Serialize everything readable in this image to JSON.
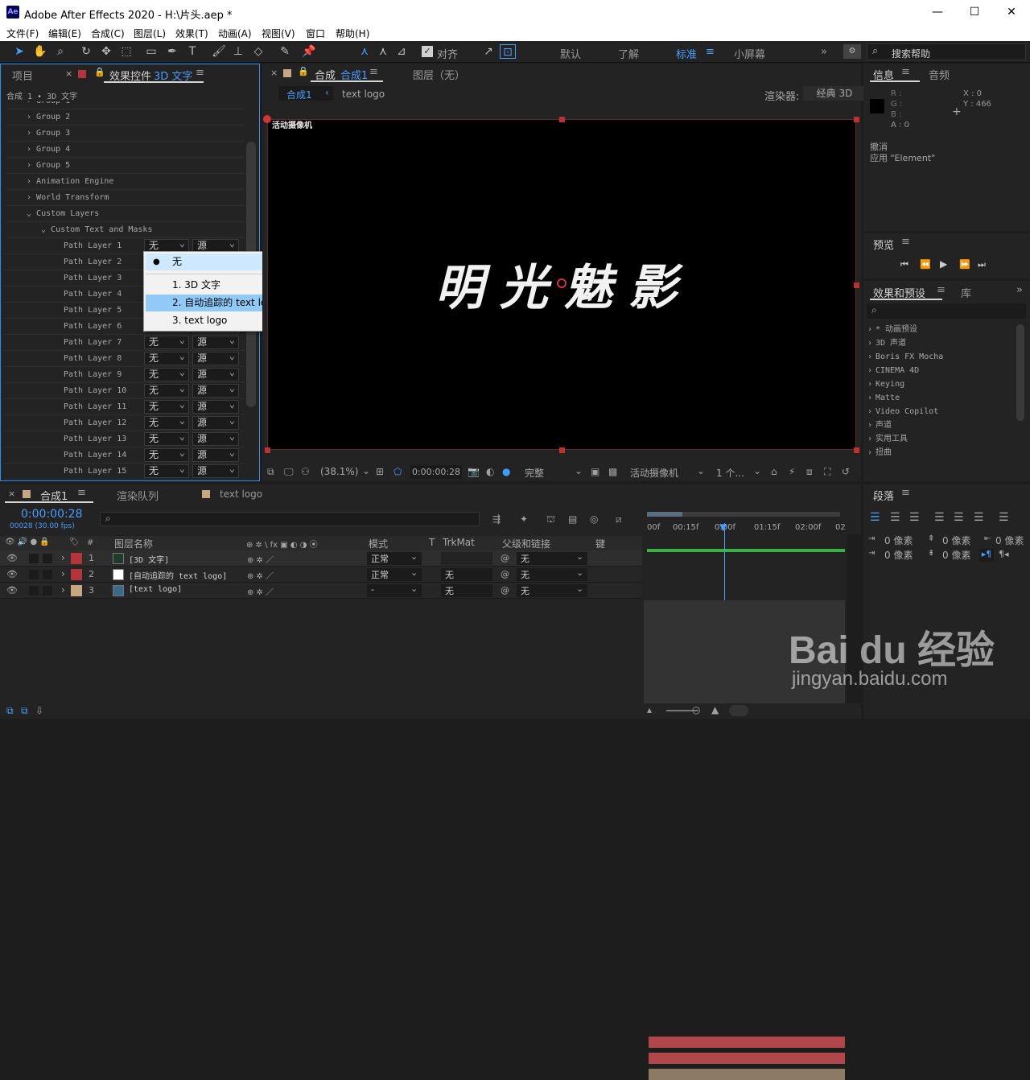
{
  "app": {
    "title": "Adobe After Effects 2020 - H:\\片头.aep *",
    "logo": "Ae"
  },
  "menu": [
    "文件(F)",
    "编辑(E)",
    "合成(C)",
    "图层(L)",
    "效果(T)",
    "动画(A)",
    "视图(V)",
    "窗口",
    "帮助(H)"
  ],
  "toolbar": {
    "align_label": "对齐",
    "workspaces": [
      "默认",
      "了解",
      "标准",
      "小屏幕"
    ],
    "active_workspace": "标准",
    "search_placeholder": "搜索帮助"
  },
  "left_panel": {
    "tab_project": "项目",
    "tab_effects": "效果控件",
    "tab_effects_layer": "3D 文字",
    "breadcrumb": "合成 1 • 3D 文字",
    "rows": [
      "Group 2",
      "Group 3",
      "Group 4",
      "Group 5",
      "Animation Engine",
      "World Transform",
      "Custom Layers",
      "Custom Text and Masks",
      "Path Layer 1",
      "Path Layer 2",
      "Path Layer 3",
      "Path Layer 4",
      "Path Layer 5",
      "Path Layer 6",
      "Path Layer 7",
      "Path Layer 8",
      "Path Layer 9",
      "Path Layer 10",
      "Path Layer 11",
      "Path Layer 12",
      "Path Layer 13",
      "Path Layer 14",
      "Path Layer 15"
    ],
    "dropdown_none": "无",
    "dropdown_source": "源"
  },
  "dropdown_menu": {
    "items": [
      "无",
      "1. 3D 文字",
      "2. 自动追踪的 text logo",
      "3. text logo"
    ],
    "selected": "无",
    "highlighted": "2. 自动追踪的 text logo"
  },
  "comp_panel": {
    "tab_label": "合成",
    "tab_name": "合成1",
    "layer_tab": "图层（无）",
    "sub_tab": "合成1",
    "sub_tab2": "text logo",
    "renderer_label": "渲染器:",
    "renderer_value": "经典 3D",
    "camera_label": "活动摄像机",
    "canvas_text": "明光魅影",
    "zoom": "(38.1%)",
    "timecode": "0:00:00:28",
    "quality": "完整",
    "view_camera": "活动摄像机",
    "views": "1 个..."
  },
  "info_panel": {
    "tab_info": "信息",
    "tab_audio": "音频",
    "r": "R :",
    "g": "G :",
    "b": "B :",
    "a": "A : 0",
    "x": "X : 0",
    "y": "Y : 466",
    "undo": "撤消",
    "apply": "应用 \"Element\""
  },
  "preview_panel": {
    "tab": "预览"
  },
  "effects_panel": {
    "tab": "效果和预设",
    "tab_lib": "库",
    "items": [
      "* 动画预设",
      "3D 声道",
      "Boris FX Mocha",
      "CINEMA 4D",
      "Keying",
      "Matte",
      "Video Copilot",
      "声道",
      "实用工具",
      "扭曲"
    ]
  },
  "timeline": {
    "tab": "合成1",
    "render_queue": "渲染队列",
    "tab3": "text logo",
    "timecode": "0:00:00:28",
    "fps": "00028 (30.00 fps)",
    "col_layer_name": "图层名称",
    "col_mode": "模式",
    "col_t": "T",
    "col_trkmat": "TrkMat",
    "col_parent": "父级和链接",
    "col_key": "键",
    "ruler": [
      "00f",
      "00:15f",
      "0:00f",
      "01:15f",
      "02:00f",
      "02"
    ],
    "layers": [
      {
        "num": "1",
        "name": "[3D 文字]",
        "mode": "正常",
        "trkmat": "",
        "parent": "无",
        "color": "#b3343a"
      },
      {
        "num": "2",
        "name": "[自动追踪的 text logo]",
        "mode": "正常",
        "trkmat": "无",
        "parent": "无",
        "color": "#b3343a"
      },
      {
        "num": "3",
        "name": "[text logo]",
        "mode": "-",
        "trkmat": "无",
        "parent": "无",
        "color": "#c7a781"
      }
    ]
  },
  "paragraph_panel": {
    "tab": "段落",
    "px1": "0 像素",
    "px2": "0 像素",
    "px3": "0 像素",
    "px4": "0 像素",
    "px5": "0 像素"
  },
  "watermark": {
    "brand": "Bai du 经验",
    "url": "jingyan.baidu.com"
  }
}
